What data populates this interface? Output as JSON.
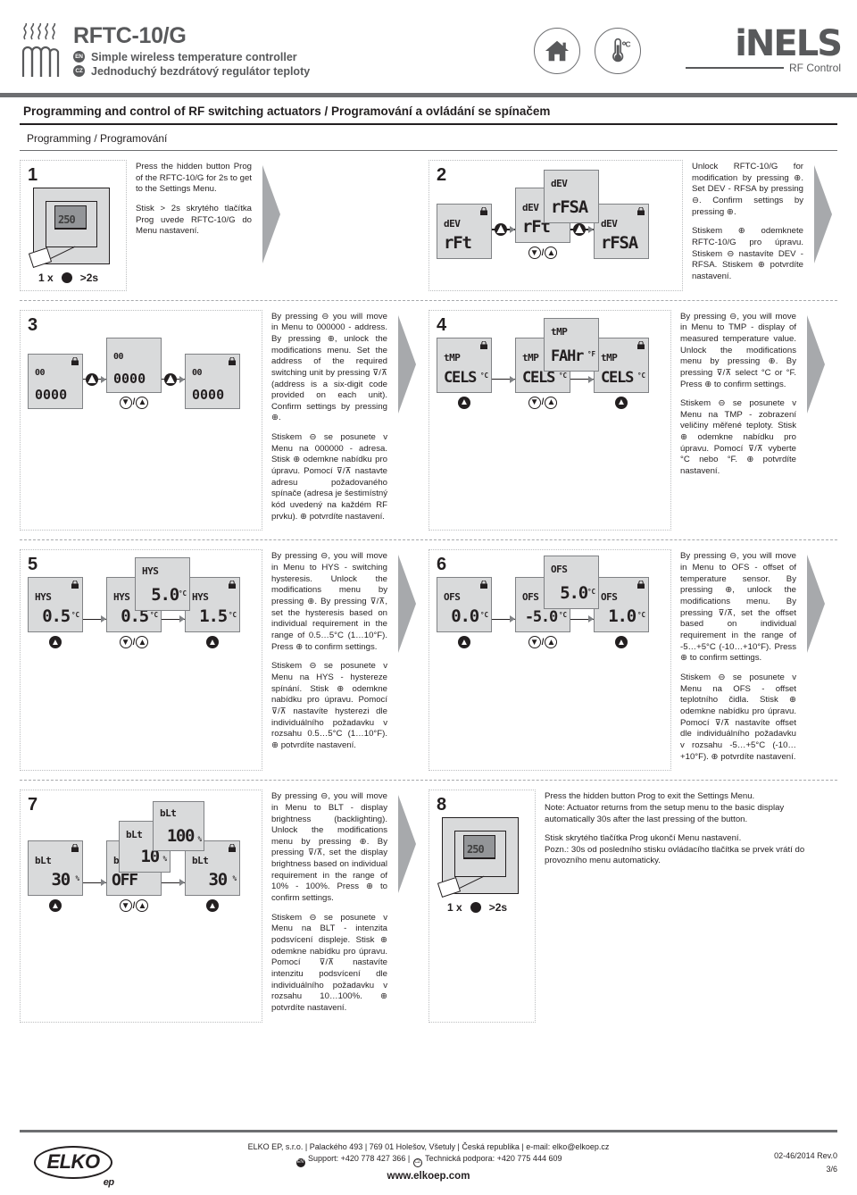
{
  "header": {
    "product": "RFTC-10/G",
    "lang_en_badge": "EN",
    "lang_en_text": "Simple wireless temperature controller",
    "lang_cz_badge": "CZ",
    "lang_cz_text": "Jednoduchý bezdrátový regulátor teploty",
    "icons": [
      "home-icon",
      "thermometer-celsius-icon"
    ],
    "brand": "iNELS",
    "brand_sub": "RF Control"
  },
  "section": {
    "title": "Programming and control of RF switching actuators / Programování a ovládání se spínačem",
    "subtitle": "Programming / Programování"
  },
  "steps": [
    {
      "num": "1",
      "device_value": "250",
      "legend_count": "1 x",
      "legend_time": ">2s",
      "text_en": "Press the hidden button Prog of the RFTC-10/G for 2s to get to the Settings Menu.",
      "text_cz": "Stisk > 2s skrytého tlačítka Prog uvede RFTC-10/G do Menu nastavení."
    },
    {
      "num": "2",
      "displays": [
        {
          "top": "dEV",
          "main": "rFt",
          "lock": true
        },
        {
          "top": "dEV",
          "main": "rFt",
          "lock": false
        },
        {
          "top": "dEV",
          "main": "rFSA",
          "lock": false
        },
        {
          "top": "dEV",
          "main": "rFSA",
          "lock": true
        }
      ],
      "text_en": "Unlock RFTC-10/G for modification by pressing ⊕. Set DEV - RFSA by pressing ⊖. Confirm settings by pressing ⊕.",
      "text_cz": "Stiskem ⊕ odemknete RFTC-10/G pro úpravu. Stiskem ⊖ nastavíte DEV - RFSA. Stiskem ⊕ potvrdíte nastavení."
    },
    {
      "num": "3",
      "displays": [
        {
          "top": "00",
          "main": "0000",
          "lock": true
        },
        {
          "top": "00",
          "main": "0000",
          "lock": false
        },
        {
          "top": "00",
          "main": "0000",
          "lock": true
        }
      ],
      "text_en": "By pressing ⊖ you will move in Menu to 000000 - address. By pressing ⊕, unlock the modifications menu. Set the address of the required switching unit by pressing ⊽/⊼ (address is a six-digit code provided on each unit). Confirm settings by pressing ⊕.",
      "text_cz": "Stiskem ⊖ se posunete v Menu na 000000 - adresa. Stisk ⊕ odemkne nabídku pro úpravu. Pomocí ⊽/⊼ nastavte adresu požadovaného spínače (adresa je šestimístný kód uvedený na každém RF prvku). ⊕ potvrdíte nastavení."
    },
    {
      "num": "4",
      "displays": [
        {
          "top": "tMP",
          "main": "CELS",
          "unit": "°C",
          "lock": true
        },
        {
          "top": "tMP",
          "main": "CELS",
          "unit": "°C",
          "lock": false
        },
        {
          "top": "tMP",
          "main": "FAHr",
          "unit": "°F",
          "lock": false
        },
        {
          "top": "tMP",
          "main": "CELS",
          "unit": "°C",
          "lock": true
        }
      ],
      "text_en": "By pressing ⊖, you will move in Menu to TMP - display of measured temperature value. Unlock the modifications menu by pressing ⊕. By pressing ⊽/⊼ select °C or °F. Press ⊕ to confirm settings.",
      "text_cz": "Stiskem ⊖ se posunete v Menu na TMP - zobrazení veličiny měřené teploty. Stisk ⊕ odemkne nabídku pro úpravu. Pomocí ⊽/⊼ vyberte °C nebo °F. ⊕ potvrdíte nastavení."
    },
    {
      "num": "5",
      "displays": [
        {
          "top": "HYS",
          "main": "0.5",
          "unit": "°C",
          "lock": true
        },
        {
          "top": "HYS",
          "main": "0.5",
          "unit": "°C",
          "lock": false
        },
        {
          "top": "HYS",
          "main": "5.0",
          "unit": "°C",
          "lock": false
        },
        {
          "top": "HYS",
          "main": "1.5",
          "unit": "°C",
          "lock": true
        }
      ],
      "text_en": "By pressing ⊖, you will move in Menu to HYS - switching hysteresis. Unlock the modifications menu by pressing ⊕. By pressing ⊽/⊼, set the hysteresis based on individual requirement in the range of 0.5…5°C (1…10°F). Press ⊕ to confirm settings.",
      "text_cz": "Stiskem ⊖ se posunete v Menu na HYS - hystereze spínání. Stisk ⊕ odemkne nabídku pro úpravu. Pomocí ⊽/⊼ nastavíte hysterezi dle individuálního požadavku v rozsahu 0.5…5°C (1…10°F). ⊕ potvrdíte nastavení."
    },
    {
      "num": "6",
      "displays": [
        {
          "top": "OFS",
          "main": "0.0",
          "unit": "°C",
          "lock": true
        },
        {
          "top": "OFS",
          "main": "-5.0",
          "unit": "°C",
          "lock": false
        },
        {
          "top": "OFS",
          "main": "5.0",
          "unit": "°C",
          "lock": false
        },
        {
          "top": "OFS",
          "main": "1.0",
          "unit": "°C",
          "lock": true
        }
      ],
      "text_en": "By pressing ⊖, you will move in Menu to OFS - offset of temperature sensor. By pressing ⊕, unlock the modifications menu. By pressing ⊽/⊼, set the offset based on individual requirement in the range of -5…+5°C (-10…+10°F). Press ⊕ to confirm settings.",
      "text_cz": "Stiskem ⊖ se posunete v Menu na OFS - offset teplotního čidla. Stisk ⊕ odemkne nabídku pro úpravu. Pomocí ⊽/⊼ nastavíte offset dle individuálního požadavku v rozsahu -5…+5°C (-10…+10°F). ⊕ potvrdíte nastavení."
    },
    {
      "num": "7",
      "displays": [
        {
          "top": "bLt",
          "main": "30",
          "unit": "%",
          "lock": true
        },
        {
          "top": "bLt",
          "main": "OFF",
          "unit": "",
          "lock": false
        },
        {
          "top": "bLt",
          "main": "10",
          "unit": "%",
          "lock": false
        },
        {
          "top": "bLt",
          "main": "100",
          "unit": "%",
          "lock": false
        },
        {
          "top": "bLt",
          "main": "30",
          "unit": "%",
          "lock": true
        }
      ],
      "text_en": "By pressing ⊖, you will move in Menu to BLT - display brightness (backlighting). Unlock the modifications menu by pressing ⊕. By pressing ⊽/⊼, set the display brightness based on individual requirement in the range of 10% - 100%. Press ⊕ to confirm settings.",
      "text_cz": "Stiskem ⊖ se posunete v Menu na BLT - intenzita podsvícení displeje. Stisk ⊕ odemkne nabídku pro úpravu. Pomocí ⊽/⊼ nastavíte intenzitu podsvícení dle individuálního požadavku v rozsahu 10…100%. ⊕ potvrdíte nastavení."
    },
    {
      "num": "8",
      "device_value": "250",
      "legend_count": "1 x",
      "legend_time": ">2s",
      "text_en": "Press the hidden button Prog to exit the Settings Menu.\nNote: Actuator returns from the setup menu to the basic display automatically 30s after the last pressing of the button.",
      "text_cz": "Stisk skrytého tlačítka Prog ukončí Menu nastavení.\nPozn.: 30s od posledního stisku ovládacího tlačítka se prvek vrátí do provozního menu automaticky."
    }
  ],
  "footer": {
    "brand": "ELKO",
    "brand_sub": "ep",
    "line1": "ELKO EP, s.r.o. | Palackého 493 | 769 01 Holešov, Všetuly | Česká republika | e-mail: elko@elkoep.cz",
    "line2_en_badge": "EN",
    "line2_en": "Support: +420 778 427 366 |",
    "line2_cz_badge": "CZ",
    "line2_cz": "Technická podpora: +420 775 444 609",
    "www": "www.elkoep.com",
    "revision": "02-46/2014 Rev.0",
    "page": "3/6"
  }
}
